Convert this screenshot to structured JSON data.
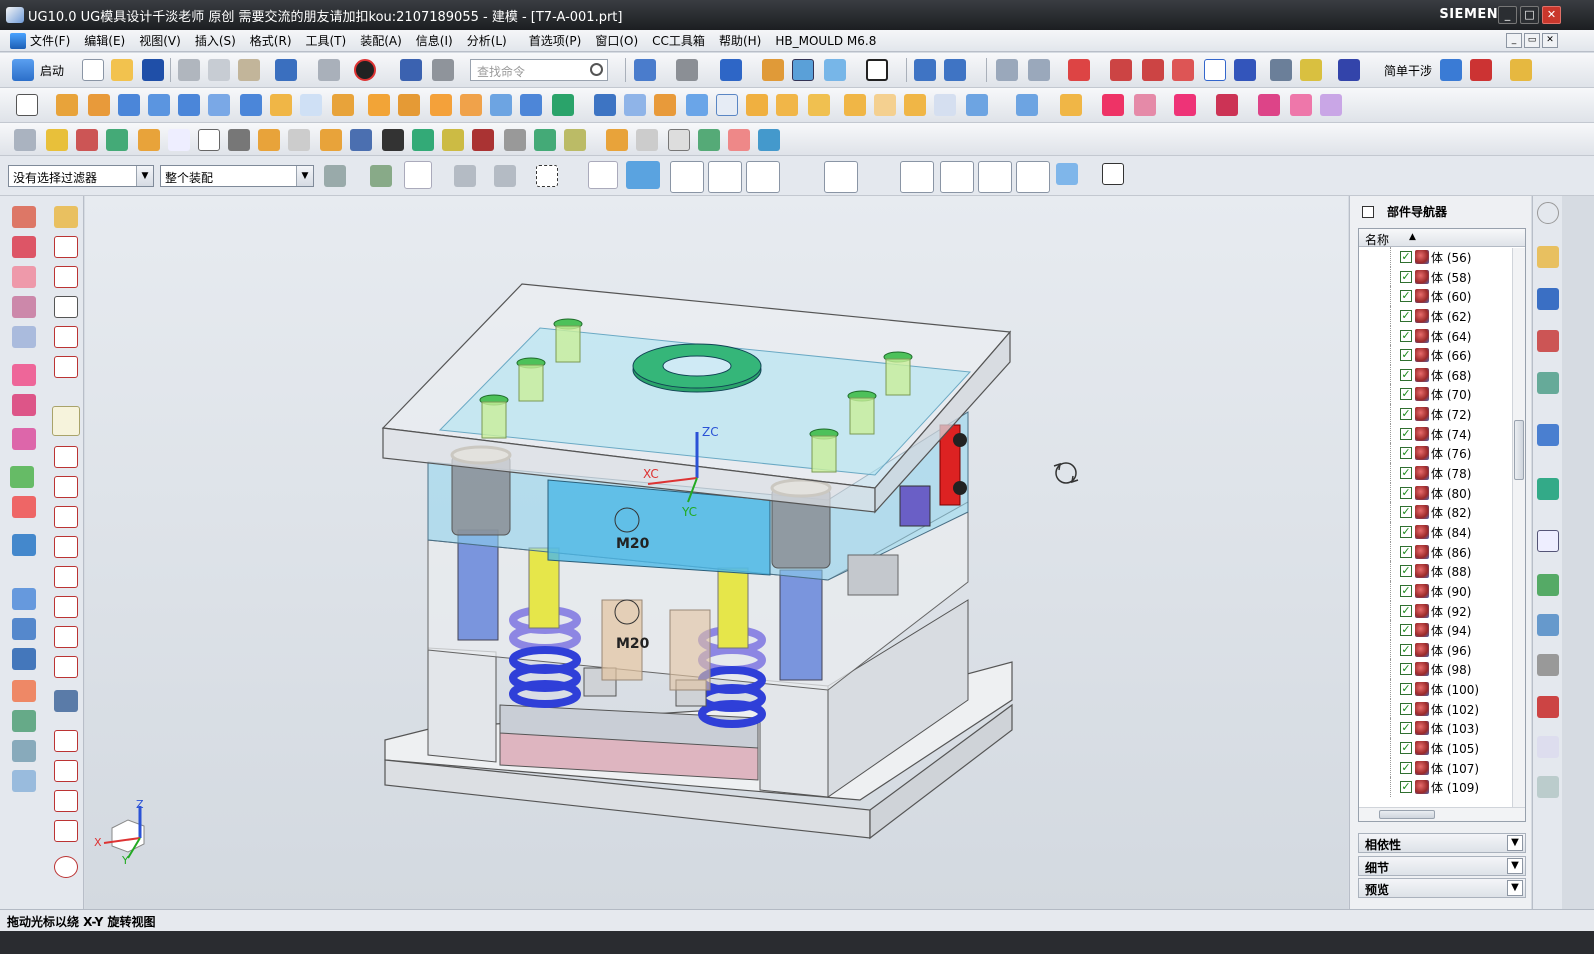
{
  "window": {
    "title": "UG10.0  UG模具设计千淡老师 原创 需要交流的朋友请加扣kou:2107189055 - 建模 - [T7-A-001.prt]",
    "brand": "SIEMENS",
    "min": "_",
    "max": "□",
    "close": "✕"
  },
  "menu": [
    "文件(F)",
    "编辑(E)",
    "视图(V)",
    "插入(S)",
    "格式(R)",
    "工具(T)",
    "装配(A)",
    "信息(I)",
    "分析(L)",
    "首选项(P)",
    "窗口(O)",
    "CC工具箱",
    "帮助(H)",
    "HB_MOULD M6.8"
  ],
  "toolbar": {
    "start_label": "启动",
    "search_placeholder": "查找命令",
    "simple_interference": "简单干涉"
  },
  "selection": {
    "filter": "没有选择过滤器",
    "scope": "整个装配"
  },
  "navigator": {
    "title": "部件导航器",
    "column": "名称",
    "prefix": "体",
    "items": [
      "体 (56)",
      "体 (58)",
      "体 (60)",
      "体 (62)",
      "体 (64)",
      "体 (66)",
      "体 (68)",
      "体 (70)",
      "体 (72)",
      "体 (74)",
      "体 (76)",
      "体 (78)",
      "体 (80)",
      "体 (82)",
      "体 (84)",
      "体 (86)",
      "体 (88)",
      "体 (90)",
      "体 (92)",
      "体 (94)",
      "体 (96)",
      "体 (98)",
      "体 (100)",
      "体 (102)",
      "体 (103)",
      "体 (105)",
      "体 (107)",
      "体 (109)"
    ],
    "sections": [
      "相依性",
      "细节",
      "预览"
    ]
  },
  "viewport": {
    "axis_labels": {
      "zc": "ZC",
      "xc": "XC",
      "yc": "YC",
      "z": "Z",
      "x": "X",
      "y": "Y"
    },
    "part_labels": [
      "M20",
      "M20"
    ]
  },
  "status": {
    "message": "拖动光标以绕 X-Y 旋转视图"
  },
  "colors": {
    "mold_cyan": "#8fd6ee",
    "spring_blue": "#2f3fd8",
    "pin_yellow": "#e6e64a",
    "bushing_green": "#2aa36a",
    "plate_pink": "#d9a6b3"
  }
}
